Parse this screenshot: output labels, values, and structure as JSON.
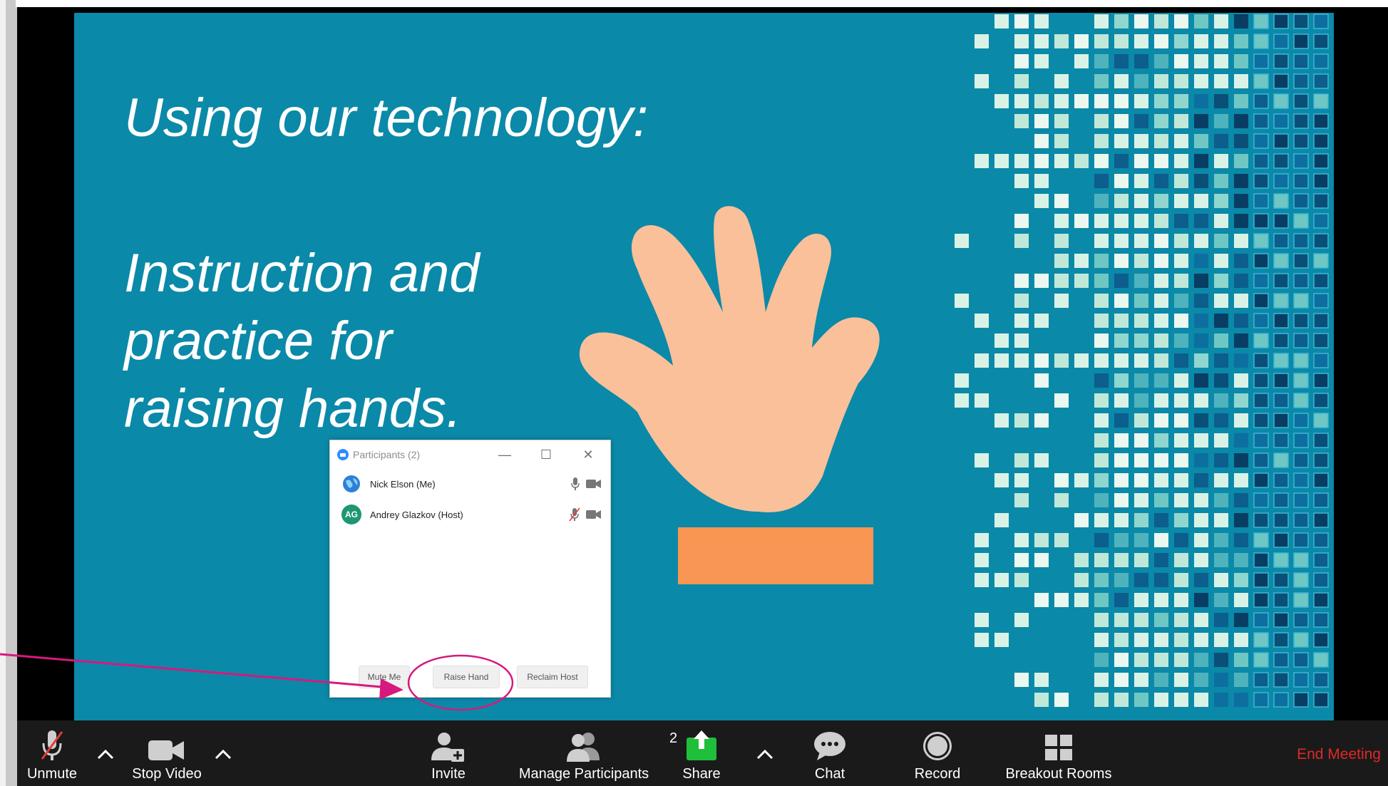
{
  "slide": {
    "title": "Using our technology:",
    "body_lines": [
      "Instruction and",
      "practice for",
      "raising hands."
    ],
    "background_color": "#0b89a8"
  },
  "participants_window": {
    "title": "Participants (2)",
    "participants": [
      {
        "name": "Nick Elson (Me)",
        "avatar_icon": "globe-avatar-icon",
        "mic": "unmuted",
        "video": "on"
      },
      {
        "name": "Andrey Glazkov (Host)",
        "avatar_initials": "AG",
        "mic": "muted",
        "video": "on"
      }
    ],
    "buttons": {
      "mute_me": "Mute Me",
      "raise_hand": "Raise Hand",
      "reclaim_host": "Reclaim Host"
    }
  },
  "toolbar": {
    "unmute": "Unmute",
    "stop_video": "Stop Video",
    "invite": "Invite",
    "manage_participants": "Manage Participants",
    "participant_count": "2",
    "share": "Share",
    "chat": "Chat",
    "record": "Record",
    "breakout_rooms": "Breakout Rooms",
    "end_meeting": "End Meeting"
  },
  "colors": {
    "accent_annotation": "#d6197d",
    "share_green": "#1fbf3a",
    "end_meeting_red": "#e02828",
    "hand": "#f9c09a",
    "cuff": "#f99653"
  }
}
